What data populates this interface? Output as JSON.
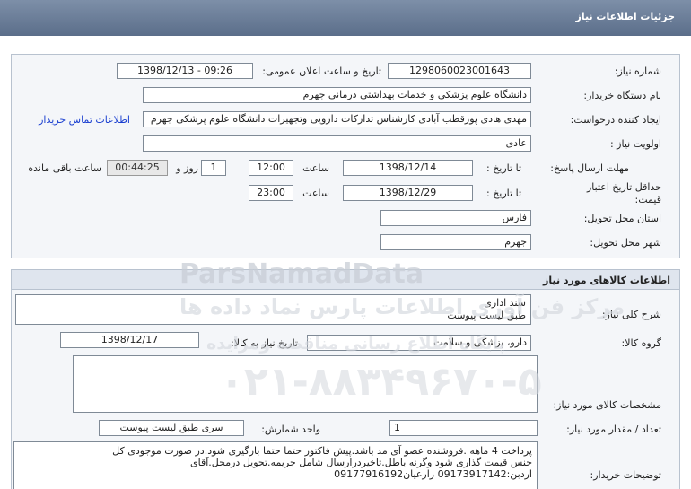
{
  "header": {
    "title": "جزئیات اطلاعات نیاز"
  },
  "need_info": {
    "need_number_label": "شماره نیاز:",
    "need_number": "1298060023001643",
    "announce_label": "تاریخ و ساعت اعلان عمومی:",
    "announce_value": "1398/12/13 - 09:26",
    "buyer_org_label": "نام دستگاه خریدار:",
    "buyer_org": "دانشگاه علوم پزشکی و خدمات بهداشتی درمانی جهرم",
    "requester_label": "ایجاد کننده درخواست:",
    "requester": "مهدی هادی پورقطب آبادی کارشناس تدارکات دارویی وتجهیزات دانشگاه علوم پزشکی جهرم",
    "contact_link": "اطلاعات تماس خریدار",
    "priority_label": "اولویت نیاز :",
    "priority": "عادی",
    "deadline_label": "مهلت ارسال پاسخ:",
    "to_date_label": "تا تاریخ :",
    "deadline_date": "1398/12/14",
    "time_label": "ساعت",
    "deadline_time": "12:00",
    "days_count": "1",
    "day_and_label": "روز و",
    "remaining_time": "00:44:25",
    "remaining_label": "ساعت باقی مانده",
    "validity_label": "حداقل تاریخ اعتبار قیمت:",
    "validity_to_label": "تا تاریخ :",
    "validity_date": "1398/12/29",
    "validity_time_label": "ساعت",
    "validity_time": "23:00",
    "province_label": "استان محل تحویل:",
    "province": "فارس",
    "city_label": "شهر محل تحویل:",
    "city": "جهرم"
  },
  "goods": {
    "section_title": "اطلاعات کالاهای مورد نیاز",
    "description_label": "شرح کلی نیاز:",
    "description_line1": "سند اداری",
    "description_line2": "طبق لیست پیوست",
    "group_label": "گروه کالا:",
    "group": "دارو، پزشکی و سلامت",
    "need_date_label": "تاریخ نیاز به کالا:",
    "need_date": "1398/12/17",
    "specs_label": "مشخصات کالای مورد نیاز:",
    "specs": "",
    "quantity_label": "تعداد / مقدار مورد نیاز:",
    "quantity": "1",
    "unit_label": "واحد شمارش:",
    "unit": "سری طبق لیست پیوست",
    "buyer_notes_label": "توضیحات خریدار:",
    "buyer_notes_line1": "پرداخت 4 ماهه .فروشنده عضو آی مد باشد.پیش فاکتور حتما حتما بارگیری شود.در صورت موجودی کل",
    "buyer_notes_line2": "جنس قیمت گذاری شود وگرنه باطل.تاخیردرارسال شامل جریمه.تحویل درمحل.آقای",
    "buyer_notes_line3": "اردبن:09173917142 زارعیان09177916192"
  },
  "watermark": {
    "brand": "ParsNamadData",
    "fa_line1": "مرکز فن آوری اطلاعات پارس نماد داده ها",
    "fa_line2": "پایگاه اطلاع رسانی مناقصه ومزایده",
    "phone": "۰۲۱-۸۸۳۴۹۶۷۰-۵"
  },
  "colors": {
    "header_bg": "#6a7c97",
    "link": "#1a3fd0",
    "panel_bg": "#f4f6f9"
  }
}
